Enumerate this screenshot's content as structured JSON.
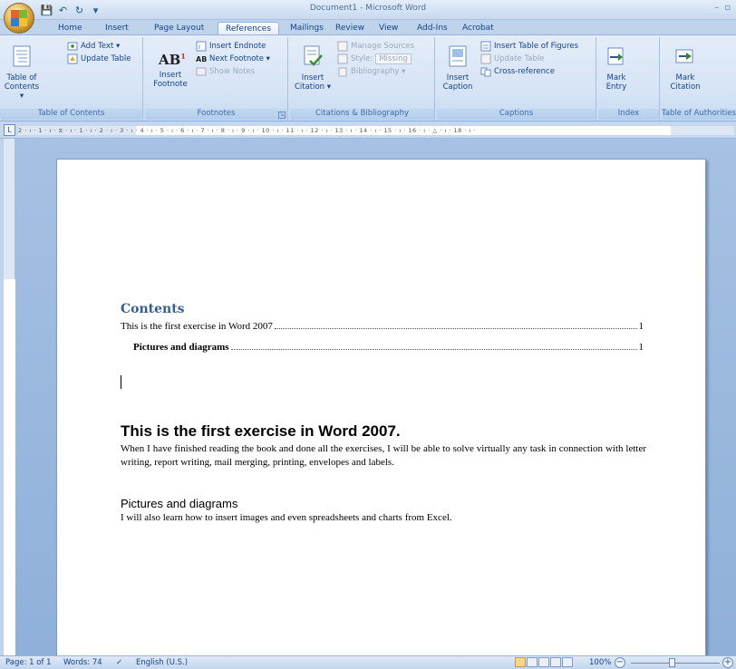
{
  "window": {
    "title": "Document1 - Microsoft Word",
    "min": "–",
    "max": "▫"
  },
  "quick_access": {
    "save": "💾",
    "undo": "↶",
    "redo": "↻",
    "more": "▾"
  },
  "tabs": [
    "Home",
    "Insert",
    "Page Layout",
    "References",
    "Mailings",
    "Review",
    "View",
    "Add-Ins",
    "Acrobat"
  ],
  "active_tab": "References",
  "ribbon": {
    "toc": {
      "label": "Table of Contents",
      "big_button": "Table of Contents ▾",
      "add_text": "Add Text ▾",
      "update_table": "Update Table"
    },
    "footnotes": {
      "label": "Footnotes",
      "insert_footnote": "Insert Footnote",
      "insert_endnote": "Insert Endnote",
      "next_footnote": "Next Footnote ▾",
      "show_notes": "Show Notes"
    },
    "citations": {
      "label": "Citations & Bibliography",
      "insert_citation": "Insert Citation ▾",
      "manage_sources": "Manage Sources",
      "style_label": "Style:",
      "style_value": "Missing",
      "bibliography": "Bibliography ▾"
    },
    "captions": {
      "label": "Captions",
      "insert_caption": "Insert Caption",
      "insert_tof": "Insert Table of Figures",
      "update_table": "Update Table",
      "cross_reference": "Cross-reference"
    },
    "index": {
      "label": "Index",
      "mark_entry": "Mark Entry"
    },
    "toa": {
      "label": "Table of Authorities",
      "mark_citation": "Mark Citation"
    }
  },
  "ruler": {
    "marks": "2 · ı · 1 · ı · ⧖ · ı · 1 · ı · 2 · ı · 3 · ı · 4 · ı · 5 · ı · 6 · ı · 7 · ı · 8 · ı · 9 · ı · 10 · ı · 11 · ı · 12 · ı · 13 · ı · 14 · ı · 15 · ı · 16 · ı · △ · ı · 18 · ı ·"
  },
  "document": {
    "toc_heading": "Contents",
    "toc_entries": [
      {
        "text": "This is the first exercise in Word 2007",
        "page": "1"
      },
      {
        "text": "Pictures and diagrams",
        "page": "1"
      }
    ],
    "heading1": "This is the first exercise in Word 2007.",
    "para1": "When I have finished reading the book and done all the exercises, I will be able to solve virtually any task in connection with letter writing, report writing, mail merging, printing, envelopes and labels.",
    "heading2": "Pictures and diagrams",
    "para2": "I will also learn how to insert images and even spreadsheets and charts from Excel."
  },
  "statusbar": {
    "page": "Page: 1 of 1",
    "words": "Words: 74",
    "language": "English (U.S.)",
    "zoom": "100%"
  },
  "colors": {
    "accent": "#15428b",
    "heading_blue": "#365f91",
    "ribbon": "#d5e3f5"
  }
}
